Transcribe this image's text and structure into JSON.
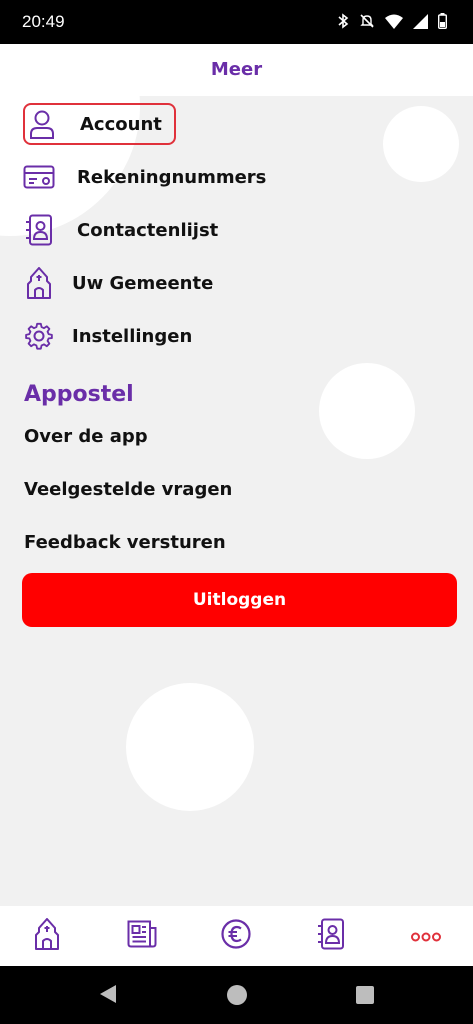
{
  "status": {
    "time": "20:49"
  },
  "header": {
    "title": "Meer"
  },
  "menu": {
    "items": [
      {
        "label": "Account",
        "icon": "person-icon"
      },
      {
        "label": "Rekeningnummers",
        "icon": "card-icon"
      },
      {
        "label": "Contactenlijst",
        "icon": "contacts-icon"
      },
      {
        "label": "Uw Gemeente",
        "icon": "church-icon"
      },
      {
        "label": "Instellingen",
        "icon": "gear-icon"
      }
    ]
  },
  "appostel": {
    "title": "Appostel",
    "links": [
      "Over de app",
      "Veelgestelde vragen",
      "Feedback versturen"
    ]
  },
  "logout_label": "Uitloggen",
  "tabs": [
    "church-icon",
    "news-icon",
    "euro-icon",
    "contacts-icon",
    "more-icon"
  ],
  "colors": {
    "accent": "#6a2ea8",
    "danger": "#ff0000",
    "highlight": "#e0313b"
  }
}
